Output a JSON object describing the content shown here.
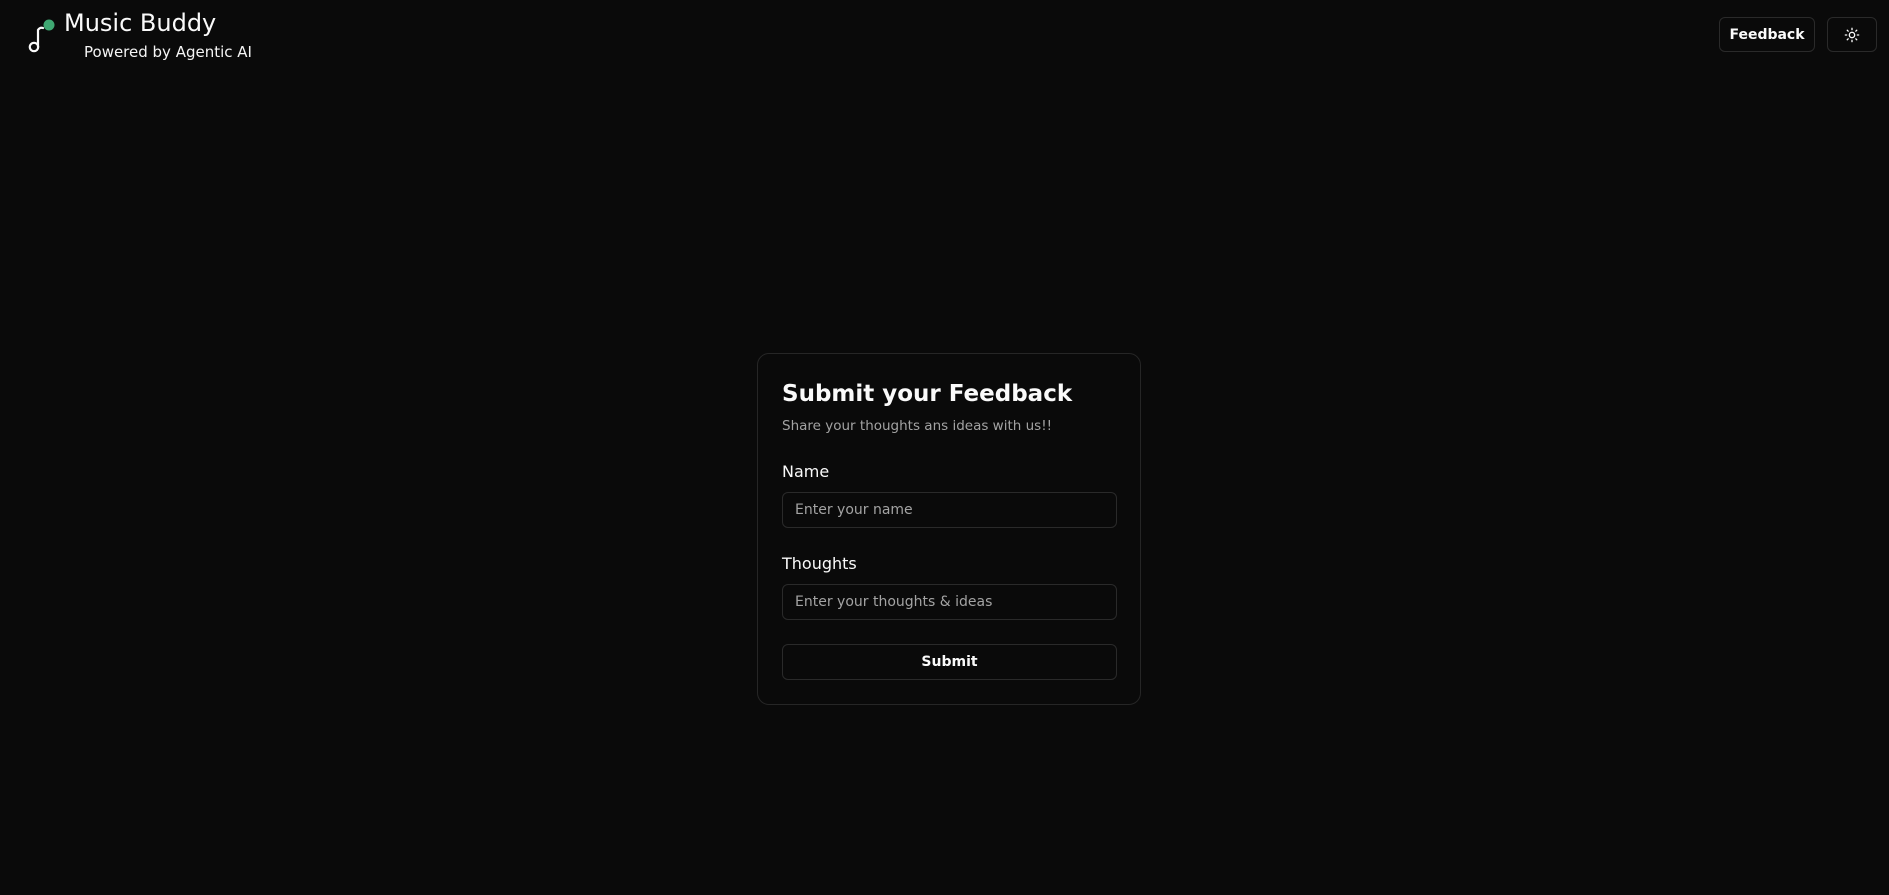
{
  "header": {
    "brand": {
      "title": "Music Buddy",
      "subtitle": "Powered by Agentic AI",
      "logo_icon": "music-note-icon",
      "logo_accent_color": "#3fa872"
    },
    "feedback_button_label": "Feedback",
    "theme_toggle_icon": "sun-icon"
  },
  "form": {
    "title": "Submit your Feedback",
    "description": "Share your thoughts ans ideas with us!!",
    "name_label": "Name",
    "name_placeholder": "Enter your name",
    "name_value": "",
    "thoughts_label": "Thoughts",
    "thoughts_placeholder": "Enter your thoughts & ideas",
    "thoughts_value": "",
    "submit_label": "Submit"
  },
  "colors": {
    "background": "#0a0a0a",
    "border": "#262626",
    "text": "#fafafa",
    "muted_text": "#a3a3a3",
    "accent": "#3fa872"
  }
}
